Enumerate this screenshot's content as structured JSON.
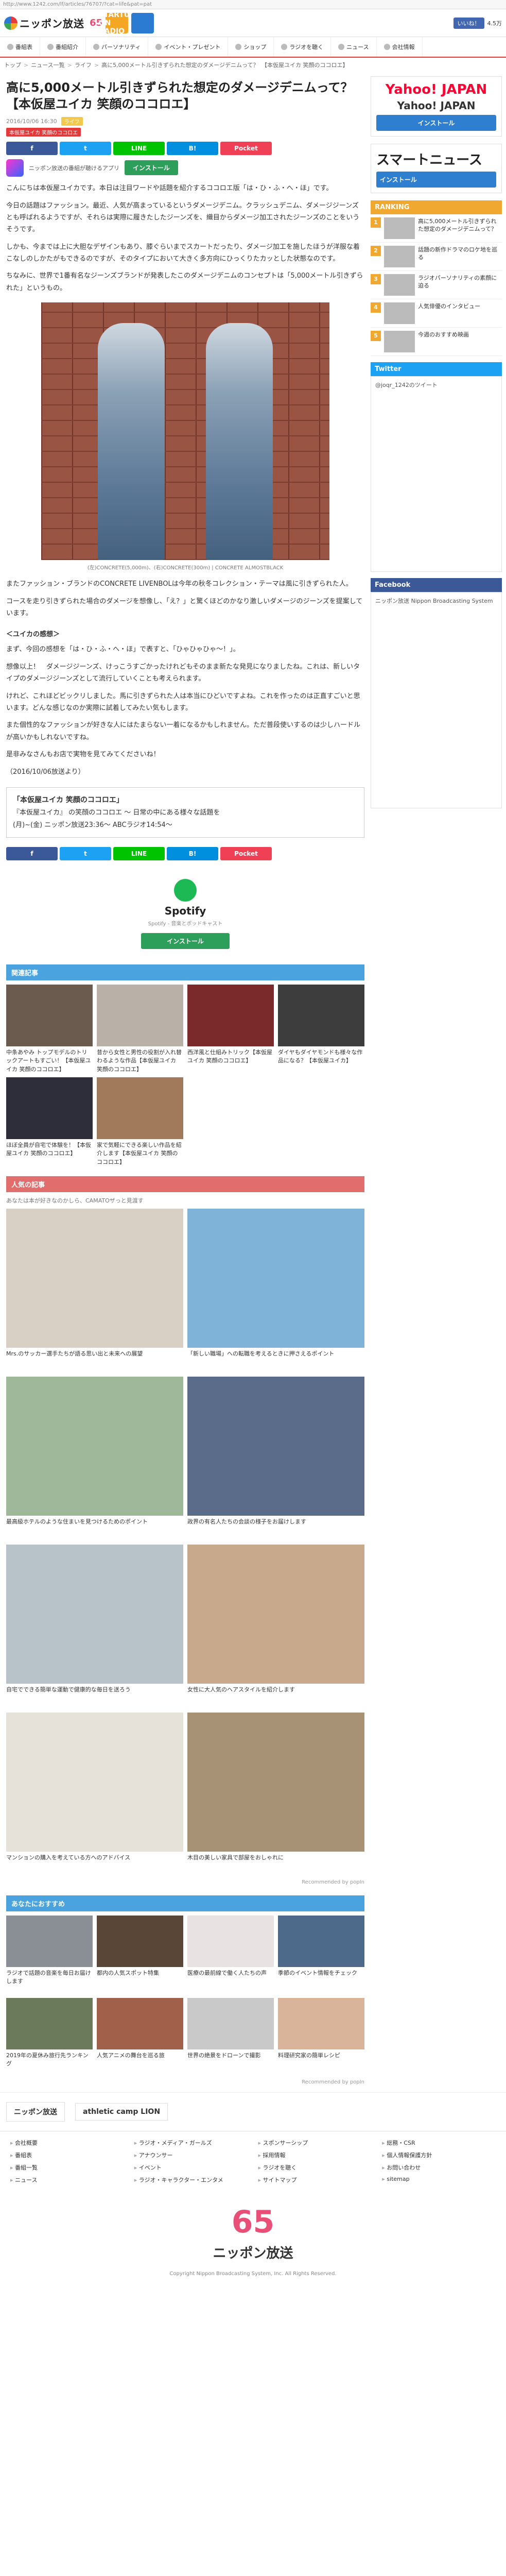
{
  "url": "http://www.1242.com/lf/articles/76707/?cat=life&pat=pat",
  "header": {
    "logo": "ニッポン放送",
    "banner_65": "65",
    "banner_label": "STARTUP ON RADIO",
    "fb_like": "いいね！",
    "fb_count": "4.5万"
  },
  "nav": [
    {
      "label": "番組表",
      "icon": "calendar-icon"
    },
    {
      "label": "番組紹介",
      "icon": "radio-icon"
    },
    {
      "label": "パーソナリティ",
      "icon": "person-icon"
    },
    {
      "label": "イベント・プレゼント",
      "icon": "gift-icon"
    },
    {
      "label": "ショップ",
      "icon": "cart-icon"
    },
    {
      "label": "ラジオを聴く",
      "icon": "play-icon"
    },
    {
      "label": "ニュース",
      "icon": "news-icon"
    },
    {
      "label": "会社情報",
      "icon": "building-icon"
    }
  ],
  "breadcrumb": [
    "トップ",
    "ニュース一覧",
    "ライフ",
    "高に5,000メートル引きずられた想定のダメージデニムって？　【本仮屋ユイカ 笑顔のココロエ】"
  ],
  "article": {
    "title": "高に5,000メートル引きずられた想定のダメージデニムって？　【本仮屋ユイカ 笑顔のココロエ】",
    "date": "2016/10/06 16:30",
    "tag": "ライフ",
    "tag2": "本仮屋ユイカ 笑顔のココロエ",
    "share": [
      "f",
      "t",
      "LINE",
      "B!",
      "Pocket"
    ],
    "app_label": "ニッポン放送の番組が聴けるアプリ",
    "install": "インストール",
    "lead": "こんにちは本仮屋ユイカです。本日は注目ワードや話題を紹介するココロエ版「は・ひ・ふ・へ・ほ」です。",
    "p1": "今日の話題はファッション。最近、人気が高まっているというダメージデニム。クラッシュデニム、ダメージジーンズとも呼ばれるようですが、それらは実際に履きたしたジーンズを、織目からダメージ加工されたジーンズのことをいうそうです。",
    "p2": "しかも、今までは上に大胆なデザインもあり、膝ぐらいまでスカートだったり、ダメージ加工を施したほうが洋服な着こなしのしかたがもできるのですが、そのタイプにおいて大きく多方向にひっくりたカッとした状態なのです。",
    "p3": "ちなみに、世界で1番有名なジーンズブランドが発表したこのダメージデニムのコンセプトは「5,000メートル引きずられた」というもの。",
    "caption": "(左)CONCRETE(5,000m)、(右)CONCRETE(300m) | CONCRETE ALMOSTBLACK",
    "p4": "またファッション・ブランドのCONCRETE LIVENBOLは今年の秋冬コレクション・テーマは風に引きずられた人。",
    "p5": "コースを走り引きずられた場合のダメージを想像し、「え？」と驚くほどのかなり激しいダメージのジーンズを提案しています。",
    "sub1": "＜ユイカの感想＞",
    "p6": "まず、今回の感想を「は・ひ・ふ・へ・ほ」で表すと、「ひゃひゃひゃ～！」。",
    "p7": "想像以上！　ダメージジーンズ、けっこうすごかったけれどもそのまま新たな発見になりましたね。これは、新しいタイプのダメージジーンズとして流行していくことも考えられます。",
    "p8": "けれど、これほどビックリしました。馬に引きずられた人は本当にひどいですよね。これを作ったのは正直すごいと思います。どんな感じなのか実際に試着してみたい気もします。",
    "p9": "また個性的なファッションが好きな人にはたまらない一着になるかもしれません。ただ普段使いするのは少しハードルが高いかもしれないですね。",
    "p10": "是非みなさんもお店で実物を見てみてくださいね！",
    "date_stamp": "（2016/10/06放送より）",
    "box_title": "「本仮屋ユイカ 笑顔のココロエ」",
    "box_l1": "『本仮屋ユイカ』 の笑顔のココロエ ～ 日常の中にある様々な話題を",
    "box_l2": "(月)~(金) ニッポン放送23:36～ ABCラジオ14:54～"
  },
  "spotify": {
    "name": "Spotify",
    "sub": "Spotify - 音楽とポッドキャスト",
    "install": "インストール"
  },
  "related": {
    "heading": "関連記事",
    "items": [
      "中条あやみ トップモデルのトリックアートもすごい！【本仮屋ユイカ 笑顔のココロエ】",
      "昔から女性と男性の役割が入れ替わるような作品【本仮屋ユイカ 笑顔のココロエ】",
      "西洋風と仕組みトリック【本仮屋ユイカ 笑顔のココロエ】",
      "ダイヤもダイヤモンドも様々な作品になる？【本仮屋ユイカ】",
      "ほぼ全員が自宅で体験を！【本仮屋ユイカ 笑顔のココロエ】",
      "家で気軽にできる楽しい作品を紹介します【本仮屋ユイカ 笑顔のココロエ】"
    ]
  },
  "recommend": {
    "heading": "人気の記事",
    "note": "あなたは本が好きなのかしら、CAMATOザっと見渡す",
    "items": [
      "Mrs.のサッカー選手たちが語る思い出と未来への展望",
      "「新しい職場」への転職を考えるときに押さえるポイント",
      "最高級ホテルのような住まいを見つけるためのポイント",
      "政界の有名人たちの会談の様子をお届けします",
      "自宅でできる簡単な運動で健康的な毎日を送ろう",
      "女性に大人気のヘアスタイルを紹介します",
      "マンションの購入を考えている方へのアドバイス",
      "木目の美しい家具で部屋をおしゃれに"
    ],
    "popin": "Recommended by popIn"
  },
  "more": {
    "heading": "あなたにおすすめ",
    "items": [
      "ラジオで話題の音楽を毎日お届けします",
      "都内の人気スポット特集",
      "医療の最前線で働く人たちの声",
      "季節のイベント情報をチェック",
      "2019年の夏休み旅行先ランキング",
      "人気アニメの舞台を巡る旅",
      "世界の絶景をドローンで撮影",
      "料理研究家の簡単レシピ"
    ],
    "popin": "Recommended by popIn"
  },
  "sidebar": {
    "yahoo_logo": "Yahoo! JAPAN",
    "yahoo_text": "Yahoo! JAPAN",
    "yahoo_btn": "インストール",
    "smart_title": "スマートニュース",
    "smart_btn": "インストール",
    "ranking_heading": "RANKING",
    "ranking": [
      "高に5,000メートル引きずられた想定のダメージデニムって？",
      "話題の新作ドラマのロケ地を巡る",
      "ラジオパーソナリティの素顔に迫る",
      "人気俳優のインタビュー",
      "今週のおすすめ映画"
    ],
    "twitter_heading": "Twitter",
    "twitter_text": "@joqr_1242のツイート",
    "facebook_heading": "Facebook",
    "facebook_text": "ニッポン放送 Nippon Broadcasting System"
  },
  "footer": {
    "sponsors": [
      "ニッポン放送",
      "athletic camp LION"
    ],
    "links": [
      "会社概要",
      "ラジオ・メディア・ガールズ",
      "スポンサーシップ",
      "総務・CSR",
      "番組表",
      "アナウンサー",
      "採用情報",
      "個人情報保護方針",
      "番組一覧",
      "イベント",
      "ラジオを聴く",
      "お問い合わせ",
      "ニュース",
      "ラジオ・キャラクター・エンタメ",
      "サイトマップ",
      "sitemap"
    ],
    "logo": "ニッポン放送",
    "big65": "65",
    "copyright": "Copyright Nippon Broadcasting System, Inc. All Rights Reserved."
  },
  "colors": {
    "accent": "#e23a3a",
    "install": "#2e9e5b",
    "related": "#4aa3df"
  }
}
